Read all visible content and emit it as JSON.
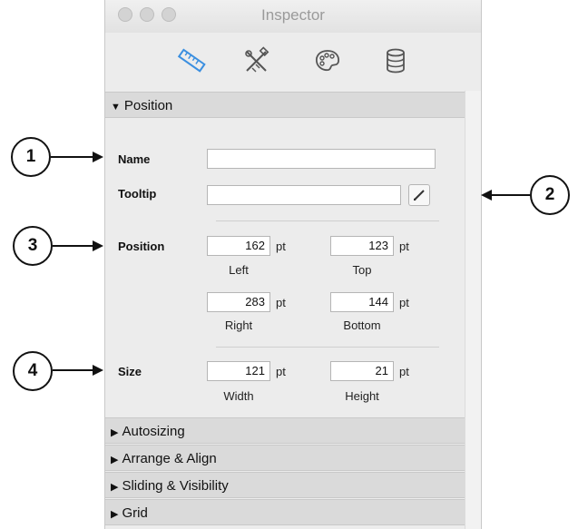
{
  "window": {
    "title": "Inspector"
  },
  "toolbar": {
    "tabs": [
      {
        "icon": "ruler-icon",
        "active": true
      },
      {
        "icon": "tools-icon",
        "active": false
      },
      {
        "icon": "palette-icon",
        "active": false
      },
      {
        "icon": "database-icon",
        "active": false
      }
    ]
  },
  "sections": {
    "position": {
      "label": "Position",
      "expanded": true
    },
    "autosizing": {
      "label": "Autosizing"
    },
    "arrange": {
      "label": "Arrange & Align"
    },
    "sliding": {
      "label": "Sliding & Visibility"
    },
    "grid": {
      "label": "Grid"
    }
  },
  "form": {
    "name_label": "Name",
    "name_value": "",
    "tooltip_label": "Tooltip",
    "tooltip_value": "",
    "position_label": "Position",
    "left_value": "162",
    "left_caption": "Left",
    "top_value": "123",
    "top_caption": "Top",
    "right_value": "283",
    "right_caption": "Right",
    "bottom_value": "144",
    "bottom_caption": "Bottom",
    "size_label": "Size",
    "width_value": "121",
    "width_caption": "Width",
    "height_value": "21",
    "height_caption": "Height",
    "unit": "pt"
  },
  "callouts": [
    "1",
    "2",
    "3",
    "4"
  ],
  "colors": {
    "accent": "#3b8fe0",
    "header_bg": "#dadada",
    "panel_bg": "#ececec"
  }
}
